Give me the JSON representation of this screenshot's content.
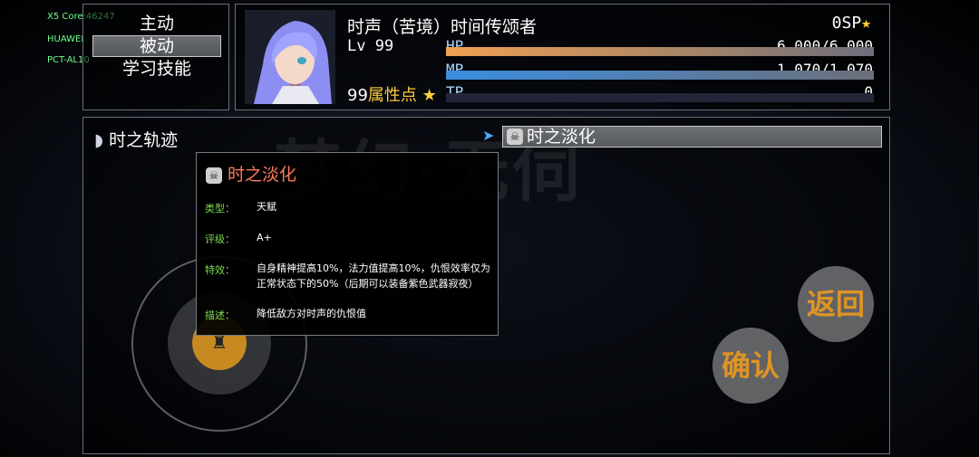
{
  "debug": [
    "X5 Core:46247",
    "HUAWEI",
    "PCT-AL10"
  ],
  "menu": {
    "items": [
      "主动",
      "被动",
      "学习技能"
    ],
    "selected": 1
  },
  "actor": {
    "name": "时声（苦境）时间传颂者",
    "sp": "0SP",
    "level": "Lv 99",
    "attr_points_value": "99",
    "attr_points_label": "属性点",
    "hp": {
      "label": "HP",
      "value": "6,000/6,000",
      "ratio": 1.0,
      "color": "#f0a050"
    },
    "mp": {
      "label": "MP",
      "value": "1,070/1,070",
      "ratio": 1.0,
      "color": "#3a8ee0"
    },
    "tp": {
      "label": "TP",
      "value": "0",
      "ratio": 0,
      "color": "#7fd0ff"
    }
  },
  "main": {
    "header": "时之轨迹",
    "selected_skill": "时之淡化",
    "watermark": "梦幻·无伺"
  },
  "tooltip": {
    "title": "时之淡化",
    "rows": [
      {
        "label": "类型：",
        "value": "天赋"
      },
      {
        "label": "评级：",
        "value": "A+"
      },
      {
        "label": "特效：",
        "value": "自身精神提高10%，法力值提高10%，仇恨效率仅为正常状态下的50%（后期可以装备紫色武器寂夜）"
      },
      {
        "label": "描述：",
        "value": "降低敌方对时声的仇恨值"
      }
    ]
  },
  "buttons": {
    "back": "返回",
    "confirm": "确认"
  },
  "icons": {
    "skill": "skull-icon",
    "header": "wing-icon",
    "cursor": "arrow-cursor-icon",
    "star": "star-icon"
  }
}
